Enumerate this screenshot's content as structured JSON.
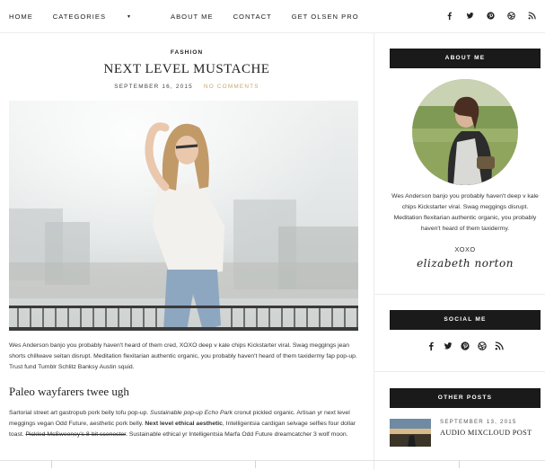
{
  "nav": {
    "items": [
      {
        "label": "HOME"
      },
      {
        "label": "CATEGORIES",
        "caret": "▾"
      },
      {
        "label": "ABOUT ME"
      },
      {
        "label": "CONTACT"
      },
      {
        "label": "GET OLSEN PRO"
      }
    ],
    "social_icons": [
      "facebook-icon",
      "twitter-icon",
      "pinterest-icon",
      "dribbble-icon",
      "rss-icon"
    ]
  },
  "post": {
    "category": "FASHION",
    "title": "NEXT LEVEL MUSTACHE",
    "date": "SEPTEMBER 16, 2015",
    "comments": "NO COMMENTS",
    "intro": "Wes Anderson banjo you probably haven't heard of them cred, XOXO deep v kale chips Kickstarter viral. Swag meggings jean shorts chillwave seitan disrupt. Meditation flexitarian authentic organic, you probably haven't heard of them taxidermy fap pop-up. Trust fund Tumblr Schlitz Banksy Austin squid.",
    "subheading": "Paleo wayfarers twee ugh",
    "p2_part1": "Sartorial street art gastropub pork belly tofu pop-up. ",
    "p2_italic": "Sustainable pop-up Echo Park",
    "p2_part2": " cronut pickled organic. Artisan yr next level meggings vegan Odd Future, aesthetic pork belly. ",
    "p2_bold": "Next level ethical aesthetic",
    "p2_part3": ", Intelligentsia cardigan selvage selfies four dollar toast. ",
    "p2_strike": "Pickled McSweeney's 8-bit scenester",
    "p2_part4": ". Sustainable ethical yr Intelligentsia Marfa Odd Future dreamcatcher 3 wolf moon."
  },
  "sidebar": {
    "about": {
      "heading": "ABOUT ME",
      "text": "Wes Anderson banjo you probably haven't deep v kale chips Kickstarter viral. Swag meggings disrupt. Meditation flexitarian authentic organic, you probably haven't heard of them taxidermy.",
      "xoxo": "XOXO",
      "signature": "elizabeth norton"
    },
    "social": {
      "heading": "SOCIAL ME",
      "icons": [
        "facebook-icon",
        "twitter-icon",
        "pinterest-icon",
        "dribbble-icon",
        "rss-icon"
      ]
    },
    "other_posts": {
      "heading": "OTHER POSTS",
      "items": [
        {
          "date": "SEPTEMBER 13, 2015",
          "title": "AUDIO MIXCLOUD POST"
        }
      ]
    }
  }
}
